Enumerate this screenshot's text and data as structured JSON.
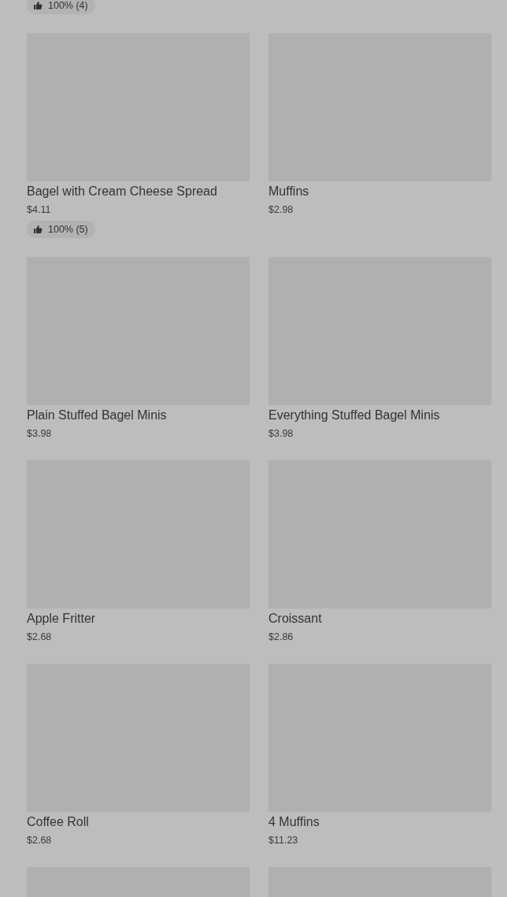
{
  "top_rating": "100% (4)",
  "products": [
    {
      "kind": "product",
      "name": "Bagel with Cream Cheese Spread",
      "price": "$4.11",
      "rating": "100% (5)"
    },
    {
      "kind": "product",
      "name": "Muffins",
      "price": "$2.98"
    },
    {
      "kind": "product",
      "name": "Plain Stuffed Bagel Minis",
      "price": "$3.98"
    },
    {
      "kind": "product",
      "name": "Everything Stuffed Bagel Minis",
      "price": "$3.98"
    },
    {
      "kind": "product",
      "name": "Apple Fritter",
      "price": "$2.68"
    },
    {
      "kind": "product",
      "name": "Croissant",
      "price": "$2.86"
    },
    {
      "kind": "product",
      "name": "Coffee Roll",
      "price": "$2.68"
    },
    {
      "kind": "product",
      "name": "4 Muffins",
      "price": "$11.23"
    },
    {
      "kind": "image_only"
    },
    {
      "kind": "image_only"
    }
  ]
}
